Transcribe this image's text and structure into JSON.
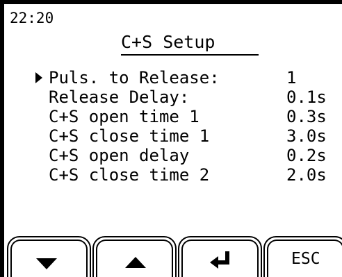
{
  "clock": "22:20",
  "title": "C+S Setup",
  "settings": [
    {
      "label": "Puls. to Release:",
      "value": "1",
      "selected": true
    },
    {
      "label": "Release Delay:",
      "value": "0.1s",
      "selected": false
    },
    {
      "label": "C+S open time 1",
      "value": "0.3s",
      "selected": false
    },
    {
      "label": "C+S close time 1",
      "value": "3.0s",
      "selected": false
    },
    {
      "label": "C+S open delay",
      "value": "0.2s",
      "selected": false
    },
    {
      "label": "C+S close time 2",
      "value": "2.0s",
      "selected": false
    }
  ],
  "softkeys": [
    {
      "name": "down",
      "icon": "arrow-down-icon"
    },
    {
      "name": "up",
      "icon": "arrow-up-icon"
    },
    {
      "name": "enter",
      "icon": "enter-icon"
    },
    {
      "name": "esc",
      "label": "ESC"
    }
  ],
  "colors": {
    "foreground": "#000000",
    "background": "#ffffff",
    "bezel": "#000000"
  }
}
